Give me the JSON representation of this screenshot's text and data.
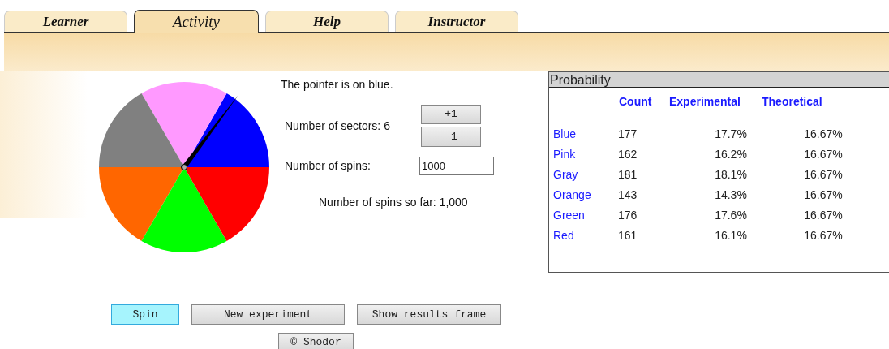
{
  "tabs": [
    {
      "label": "Learner",
      "selected": false
    },
    {
      "label": "Activity",
      "selected": true
    },
    {
      "label": "Help",
      "selected": false
    },
    {
      "label": "Instructor",
      "selected": false
    }
  ],
  "spinner": {
    "sectors": [
      {
        "color": "#0000ff"
      },
      {
        "color": "#ff99ff"
      },
      {
        "color": "#808080"
      },
      {
        "color": "#ff6600"
      },
      {
        "color": "#00ff00"
      },
      {
        "color": "#ff0000"
      }
    ]
  },
  "status": "The pointer is on blue.",
  "sectors_label": "Number of sectors: 6",
  "plus_button": "+1",
  "minus_button": "−1",
  "spins_label": "Number of spins:",
  "spins_value": "1000",
  "spins_so_far": "Number of spins so far: 1,000",
  "table": {
    "title": "Probability",
    "columns": [
      "Count",
      "Experimental",
      "Theoretical"
    ],
    "rows": [
      {
        "label": "Blue",
        "cells": [
          "177",
          "17.7%",
          "16.67%"
        ]
      },
      {
        "label": "Pink",
        "cells": [
          "162",
          "16.2%",
          "16.67%"
        ]
      },
      {
        "label": "Gray",
        "cells": [
          "181",
          "18.1%",
          "16.67%"
        ]
      },
      {
        "label": "Orange",
        "cells": [
          "143",
          "14.3%",
          "16.67%"
        ]
      },
      {
        "label": "Green",
        "cells": [
          "176",
          "17.6%",
          "16.67%"
        ]
      },
      {
        "label": "Red",
        "cells": [
          "161",
          "16.1%",
          "16.67%"
        ]
      }
    ]
  },
  "buttons": [
    {
      "label": "Spin",
      "highlighted": true
    },
    {
      "label": "New experiment",
      "highlighted": false
    },
    {
      "label": "Show results frame",
      "highlighted": false
    }
  ],
  "credit": "© Shodor"
}
